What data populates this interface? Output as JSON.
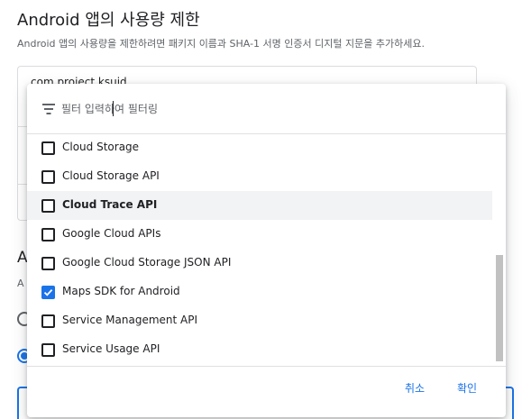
{
  "background": {
    "title": "Android 앱의 사용량 제한",
    "description": "Android 앱의 사용량을 제한하려면 패키지 이름과 SHA-1 서명 인증서 디지털 지문을 추가하세요.",
    "package_field_value": "com.project.ksuid",
    "section_title_partial": "A",
    "section_sub_partial": "A"
  },
  "filter": {
    "placeholder": "필터 입력하여 필터링",
    "icon": "filter-list-icon"
  },
  "api_list": [
    {
      "label": "Cloud Storage",
      "checked": false
    },
    {
      "label": "Cloud Storage API",
      "checked": false
    },
    {
      "label": "Cloud Trace API",
      "checked": false
    },
    {
      "label": "Google Cloud APIs",
      "checked": false
    },
    {
      "label": "Google Cloud Storage JSON API",
      "checked": false
    },
    {
      "label": "Maps SDK for Android",
      "checked": true
    },
    {
      "label": "Service Management API",
      "checked": false
    },
    {
      "label": "Service Usage API",
      "checked": false
    }
  ],
  "footer": {
    "cancel_label": "취소",
    "confirm_label": "확인"
  },
  "colors": {
    "accent": "#1a73e8",
    "text": "#202124",
    "secondary_text": "#5f6368",
    "hover": "#f1f3f4"
  }
}
